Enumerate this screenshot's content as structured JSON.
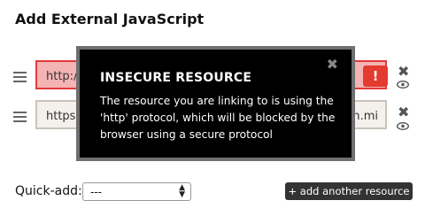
{
  "panel": {
    "title": "Add External JavaScript"
  },
  "resources": [
    {
      "url": "http://",
      "warning_label": "!"
    },
    {
      "url": "https:",
      "url_end": "om.mi"
    }
  ],
  "icons": {
    "remove": "✖",
    "close": "✖"
  },
  "tooltip": {
    "title": "INSECURE RESOURCE",
    "body": "The resource you are linking to is using the 'http' protocol, which will be blocked by the browser using a secure protocol"
  },
  "quick_add": {
    "label": "Quick-add:",
    "selected": "---"
  },
  "add_button": {
    "label": "+ add another resource"
  },
  "colors": {
    "warning": "#e43a2f",
    "warning_bg": "#f4b4b4",
    "tooltip_bg": "#000000"
  }
}
